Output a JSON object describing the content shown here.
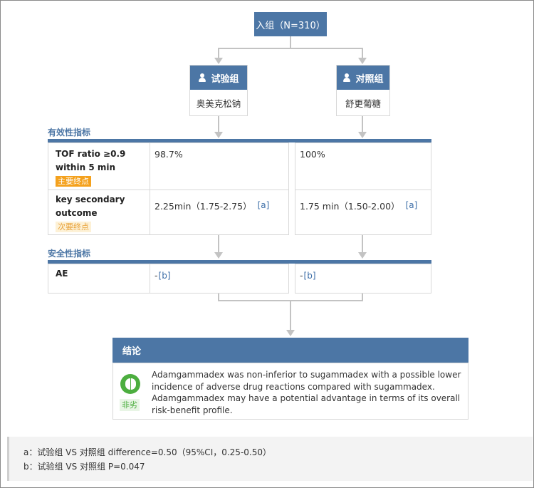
{
  "enrollment": {
    "label": "入组（N=310）"
  },
  "groups": [
    {
      "name": "试验组",
      "drug": "奥美克松钠"
    },
    {
      "name": "对照组",
      "drug": "舒更葡糖"
    }
  ],
  "efficacy": {
    "section_title": "有效性指标",
    "rows": [
      {
        "label_line1": "TOF ratio ≥0.9",
        "label_line2": "within 5 min",
        "badge": "主要终点",
        "test_value": "98.7%",
        "test_ref": "",
        "control_value": "100%",
        "control_ref": ""
      },
      {
        "label_line1": "key secondary",
        "label_line2": "outcome",
        "badge": "次要终点",
        "test_value": "2.25min（1.75-2.75）",
        "test_ref": "[a]",
        "control_value": "1.75 min（1.50-2.00）",
        "control_ref": "[a]"
      }
    ]
  },
  "safety": {
    "section_title": "安全性指标",
    "rows": [
      {
        "label": "AE",
        "test_value": "-",
        "test_ref": "[b]",
        "control_value": "-",
        "control_ref": "[b]"
      }
    ]
  },
  "conclusion": {
    "title": "结论",
    "badge": "非劣",
    "icon": "non-inferior-icon",
    "text": "Adamgammadex was non-inferior to sugammadex with a possible lower incidence of adverse drug reactions compared with sugammadex. Adamgammadex may have a potential advantage in terms of its overall risk-benefit profile."
  },
  "footnotes": [
    "a：试验组 VS 对照组 difference=0.50（95%CI，0.25-0.50）",
    "b：试验组 VS 对照组 P=0.047"
  ],
  "colors": {
    "primary": "#4c76a5",
    "badge_primary": "#f4a11d",
    "badge_secondary": "#fdf1d6",
    "success": "#4cae3f",
    "connector": "#c3c3c3"
  }
}
